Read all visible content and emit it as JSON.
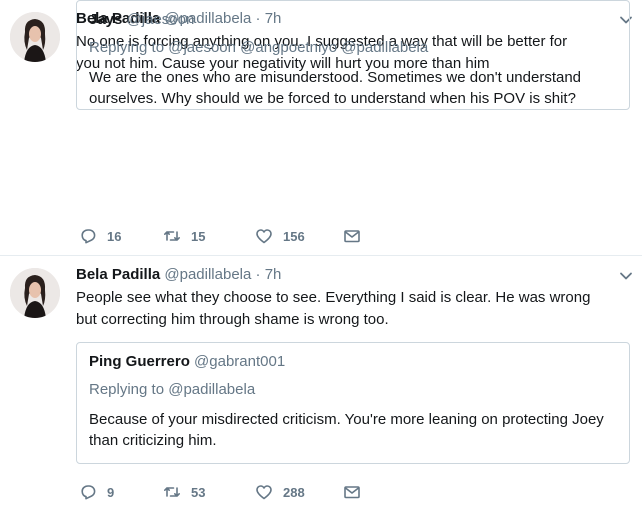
{
  "tweets": [
    {
      "author": {
        "name": "Bela Padilla",
        "handle": "@padillabela",
        "time": "7h"
      },
      "text_line1": "No one is forcing anything on you. I suggested a way that will be better for",
      "text_line2": "you not him. Cause your negativity will hurt you more than him",
      "quote": {
        "name": "Jays",
        "handle": "@jaesoon",
        "replying": "Replying to @jaesoon @angpoetniyo @padillabela",
        "text_line1": "We are the ones who are misunderstood. Sometimes we don't understand",
        "text_line2": "ourselves. Why should we be forced to understand when his POV is shit?"
      },
      "stats": {
        "replies": "16",
        "retweets": "15",
        "likes": "156"
      }
    },
    {
      "author": {
        "name": "Bela Padilla",
        "handle": "@padillabela",
        "time": "7h"
      },
      "text_line1": "People see what they choose to see. Everything I said is clear. He was wrong",
      "text_line2": "but correcting him through shame is wrong too.",
      "quote": {
        "name": "Ping Guerrero",
        "handle": "@gabrant001",
        "replying": "Replying to @padillabela",
        "text_line1": "Because of your misdirected criticism. You're more leaning on protecting Joey",
        "text_line2": "than criticizing him."
      },
      "stats": {
        "replies": "9",
        "retweets": "53",
        "likes": "288"
      }
    }
  ],
  "separator": "·",
  "icons": {
    "reply": "reply-icon",
    "retweet": "retweet-icon",
    "like": "heart-icon",
    "dm": "envelope-icon",
    "more": "chevron-down-icon"
  },
  "colors": {
    "text": "#14171a",
    "muted": "#657786",
    "border": "#ccd6dd"
  }
}
